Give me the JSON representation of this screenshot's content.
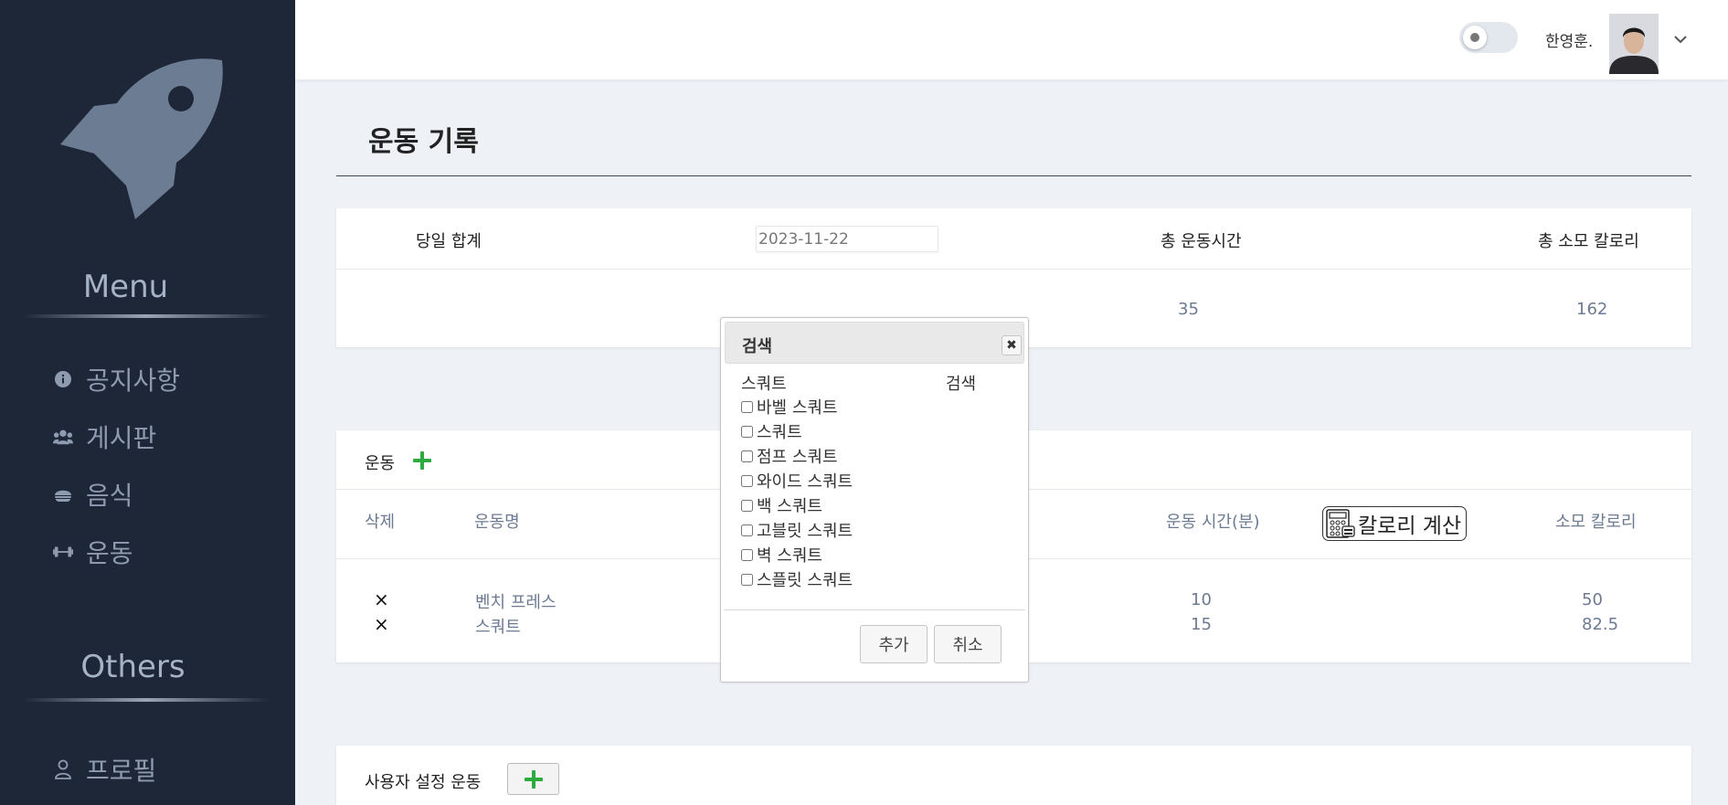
{
  "sidebar": {
    "logo_icon": "rocket-icon",
    "menu_title": "Menu",
    "items": [
      {
        "label": "공지사항",
        "icon": "info-icon"
      },
      {
        "label": "게시판",
        "icon": "users-icon"
      },
      {
        "label": "음식",
        "icon": "food-icon"
      },
      {
        "label": "운동",
        "icon": "dumbbell-icon"
      }
    ],
    "others_title": "Others",
    "others_items": [
      {
        "label": "프로필",
        "icon": "user-icon"
      }
    ]
  },
  "header": {
    "username": "한영훈.",
    "toggle_state": "off"
  },
  "page": {
    "title": "운동 기록"
  },
  "summary": {
    "label": "당일 합계",
    "date": "2023-11-22",
    "total_time_header": "총 운동시간",
    "total_calorie_header": "총 소모 칼로리",
    "total_time": "35",
    "total_calorie": "162"
  },
  "exercise": {
    "section_label": "운동",
    "columns": {
      "delete": "삭제",
      "name": "운동명",
      "time": "운동 시간(분)",
      "calorie_button": "칼로리 계산",
      "calorie": "소모 칼로리"
    },
    "rows": [
      {
        "delete": "×",
        "name": "벤치 프레스",
        "time": "10",
        "calorie": "50"
      },
      {
        "delete": "×",
        "name": "스쿼트",
        "time": "15",
        "calorie": "82.5"
      }
    ]
  },
  "custom": {
    "section_label": "사용자 설정 운동"
  },
  "dialog": {
    "title": "검색",
    "close_glyph": "✖",
    "search_term": "스쿼트",
    "search_button": "검색",
    "options": [
      "바벨 스쿼트",
      "스쿼트",
      "점프 스쿼트",
      "와이드 스쿼트",
      "백 스쿼트",
      "고블릿 스쿼트",
      "벽 스쿼트",
      "스플릿 스쿼트"
    ],
    "add_button": "추가",
    "cancel_button": "취소"
  },
  "colors": {
    "sidebar_bg": "#1e2738",
    "page_bg": "#eef2f7",
    "accent_green": "#2eab3e",
    "muted_text": "#6c7a92"
  }
}
